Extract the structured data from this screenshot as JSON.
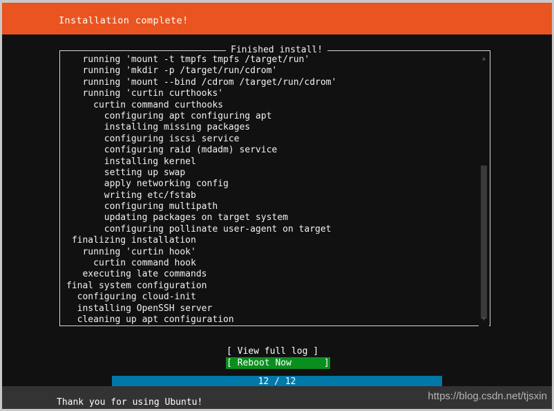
{
  "window": {
    "header_title": "Installation complete!",
    "header_color": "#e95420",
    "background_color": "#111111",
    "frame_color": "#c9c9c9"
  },
  "log_panel": {
    "legend": "Finished install!",
    "lines": [
      "   running 'mount -t tmpfs tmpfs /target/run'",
      "   running 'mkdir -p /target/run/cdrom'",
      "   running 'mount --bind /cdrom /target/run/cdrom'",
      "   running 'curtin curthooks'",
      "     curtin command curthooks",
      "       configuring apt configuring apt",
      "       installing missing packages",
      "       configuring iscsi service",
      "       configuring raid (mdadm) service",
      "       installing kernel",
      "       setting up swap",
      "       apply networking config",
      "       writing etc/fstab",
      "       configuring multipath",
      "       updating packages on target system",
      "       configuring pollinate user-agent on target",
      " finalizing installation",
      "   running 'curtin hook'",
      "     curtin command hook",
      "   executing late commands",
      "final system configuration",
      "  configuring cloud-init",
      "  installing OpenSSH server",
      "  cleaning up apt configuration"
    ],
    "scrollbar": {
      "up_arrow": "▲",
      "down_arrow": "▼",
      "thumb_color": "#3a3a3a"
    }
  },
  "buttons": {
    "view_full_log": "[ View full log ]",
    "reboot_now": "[ Reboot Now      ]",
    "reboot_highlight_color": "#0a8f1e"
  },
  "progress": {
    "label": "12 / 12",
    "current": 12,
    "total": 12,
    "bar_color": "#0079a8"
  },
  "footer": {
    "message": "Thank you for using Ubuntu!",
    "band_color": "#333333",
    "watermark": "https://blog.csdn.net/tjsxin"
  }
}
